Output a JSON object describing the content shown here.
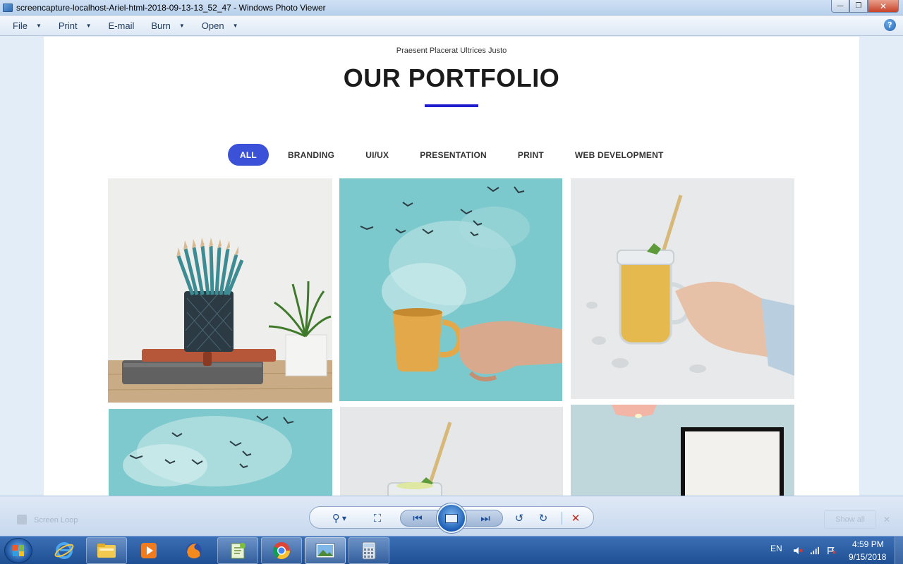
{
  "window": {
    "title": "screencapture-localhost-Ariel-html-2018-09-13-13_52_47 - Windows Photo Viewer",
    "min_glyph": "—",
    "max_glyph": "❐",
    "close_glyph": "✕"
  },
  "menu": {
    "items": [
      {
        "label": "File",
        "has_caret": true
      },
      {
        "label": "Print",
        "has_caret": true
      },
      {
        "label": "E-mail",
        "has_caret": false
      },
      {
        "label": "Burn",
        "has_caret": true
      },
      {
        "label": "Open",
        "has_caret": true
      }
    ],
    "caret_glyph": "▼",
    "help_glyph": "?"
  },
  "portfolio": {
    "subtitle": "Praesent Placerat Ultrices Justo",
    "heading": "OUR PORTFOLIO",
    "accent_color": "#1f1fd0",
    "filter_active_color": "#3a51d8",
    "filters": [
      "ALL",
      "BRANDING",
      "UI/UX",
      "PRESENTATION",
      "PRINT",
      "WEB DEVELOPMENT"
    ],
    "active_filter": "ALL",
    "tiles": [
      {
        "name": "pencils-notebook-plant"
      },
      {
        "name": "coffee-cup-birds-steam"
      },
      {
        "name": "smoothie-jar-hand"
      },
      {
        "name": "birds-clouds-sky"
      },
      {
        "name": "smoothie-jar-straw"
      },
      {
        "name": "lamp-picture-frame"
      }
    ]
  },
  "viewer_toolbar": {
    "ghost_label": "Screen Loop",
    "ghost_show": "Show all",
    "zoom_glyph": "⚲",
    "fit_glyph": "⛶",
    "prev_glyph": "⏮",
    "next_glyph": "⏭",
    "rotate_ccw_glyph": "↺",
    "rotate_cw_glyph": "↻",
    "delete_glyph": "✕"
  },
  "taskbar": {
    "language": "EN",
    "time": "4:59 PM",
    "date": "9/15/2018"
  }
}
